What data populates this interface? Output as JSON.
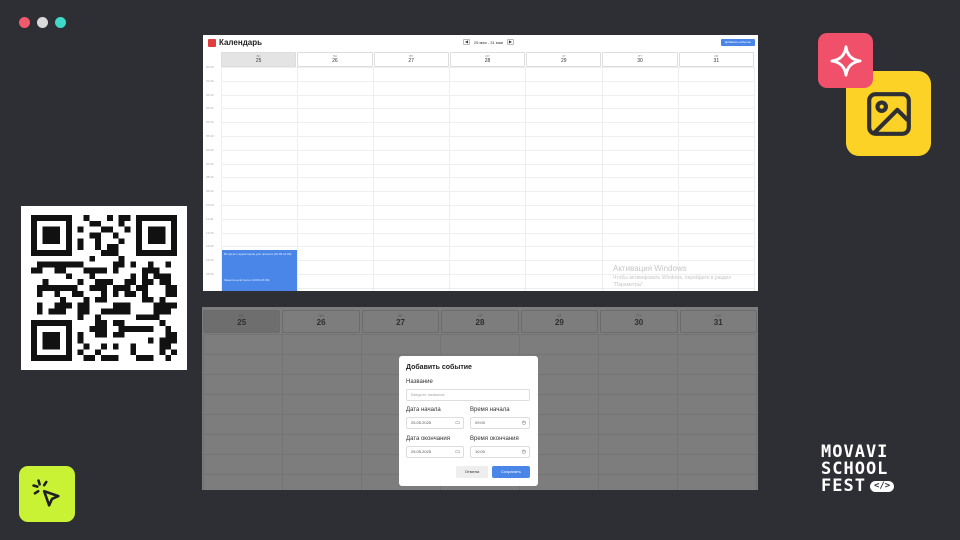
{
  "window_dots": [
    {
      "color": "#f05a6b"
    },
    {
      "color": "#d9d9d9"
    },
    {
      "color": "#3fd9c8"
    }
  ],
  "top_calendar": {
    "title": "Календарь",
    "range": "25 мая - 31 мая",
    "prev": "◀",
    "next": "▶",
    "add_button": "Добавить событие",
    "days": [
      {
        "dow": "ВС",
        "num": "25",
        "today": true
      },
      {
        "dow": "ПН",
        "num": "26"
      },
      {
        "dow": "ВТ",
        "num": "27"
      },
      {
        "dow": "СР",
        "num": "28"
      },
      {
        "dow": "ЧТ",
        "num": "29"
      },
      {
        "dow": "ПТ",
        "num": "30"
      },
      {
        "dow": "СБ",
        "num": "31"
      }
    ],
    "times": [
      "00:00",
      "01:00",
      "02:00",
      "03:00",
      "04:00",
      "05:00",
      "06:00",
      "07:00",
      "08:00",
      "09:00",
      "10:00",
      "11:00",
      "12:00",
      "13:00",
      "14:00",
      "15:00"
    ],
    "event": {
      "line1": "Встреча с директором для проекта (10:00-11:00)",
      "line2": "Защита на встрече (10:00-15:00)"
    },
    "watermark": {
      "line1": "Активация Windows",
      "line2": "Чтобы активировать Windows, перейдите в раздел \"Параметры\"."
    }
  },
  "bottom_calendar": {
    "days": [
      {
        "dow": "ВС",
        "num": "25",
        "today": true
      },
      {
        "dow": "ПН",
        "num": "26"
      },
      {
        "dow": "ВТ",
        "num": "27"
      },
      {
        "dow": "СР",
        "num": "28"
      },
      {
        "dow": "ЧТ",
        "num": "29"
      },
      {
        "dow": "ПТ",
        "num": "30"
      },
      {
        "dow": "СБ",
        "num": "31"
      }
    ]
  },
  "modal": {
    "title": "Добавить событие",
    "name_label": "Название",
    "name_placeholder": "Введите название",
    "start_date_label": "Дата начала",
    "start_date_value": "25.05.2025",
    "start_time_label": "Время начала",
    "start_time_value": "09:00",
    "end_date_label": "Дата окончания",
    "end_date_value": "25.05.2025",
    "end_time_label": "Время окончания",
    "end_time_value": "10:00",
    "cancel": "Отмена",
    "save": "Сохранить"
  },
  "logo": {
    "line1": "MOVAVI",
    "line2": "SCHOOL",
    "line3": "FEST",
    "code": "</>"
  },
  "icons": {
    "sparkle": "sparkle-icon",
    "image": "image-icon",
    "cursor": "cursor-click-icon",
    "qr": "qr-code"
  },
  "colors": {
    "background": "#2e2e35",
    "accent_blue": "#4a86e8",
    "tile_pink": "#f0506a",
    "tile_yellow": "#fcd226",
    "tile_lime": "#c9f234"
  }
}
